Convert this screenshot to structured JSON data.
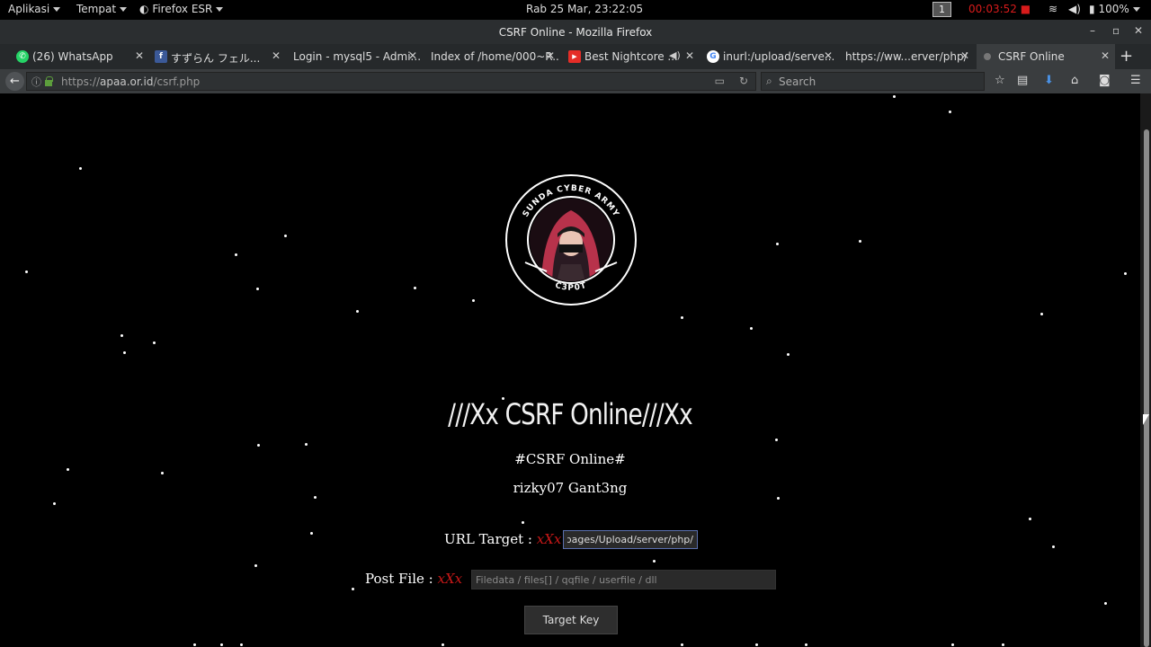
{
  "topbar": {
    "applications": "Aplikasi",
    "places": "Tempat",
    "app_name": "Firefox ESR",
    "clock": "Rab 25 Mar, 23:22:05",
    "workspace": "1",
    "recording_time": "00:03:52",
    "battery": "100%"
  },
  "window": {
    "title": "CSRF Online - Mozilla Firefox",
    "minimize": "–",
    "maximize": "▫",
    "close": "✕"
  },
  "tabs": [
    {
      "label": "(26) WhatsApp",
      "icon": "whatsapp-icon",
      "color": "#25d366"
    },
    {
      "label": "すずらん フェル...",
      "icon": "facebook-icon",
      "color": "#3b5998"
    },
    {
      "label": "Login - mysql5 - Admi...",
      "icon": "",
      "color": ""
    },
    {
      "label": "Index of /home/000~R...",
      "icon": "",
      "color": ""
    },
    {
      "label": "Best Nightcore ...",
      "icon": "youtube-icon",
      "color": "#e52d27"
    },
    {
      "label": "inurl:/upload/serve...",
      "icon": "google-icon",
      "color": "#ffffff"
    },
    {
      "label": "https://ww...erver/php/",
      "icon": "",
      "color": ""
    },
    {
      "label": "CSRF Online",
      "icon": "page-icon",
      "color": "#777777"
    }
  ],
  "nav": {
    "url_prefix": "https://",
    "url_host": "apaa.or.id",
    "url_path": "/csrf.php",
    "search_placeholder": "Search"
  },
  "page": {
    "logo_top_text": "SUNDA CYBER ARMY",
    "logo_bottom_text": "C3P0T",
    "heading": "∕∕∕Xx CSRF Online∕∕∕Xx",
    "subtitle": "#CSRF Online#",
    "authors": "rizky07 Gant3ng",
    "url_label": "URL Target : ",
    "url_marker": "xXx",
    "url_value": "/pages/Upload/server/php/",
    "post_label": "Post File : ",
    "post_marker": "xXx",
    "post_placeholder": "Filedata / files[] / qqfile / userfile / dll",
    "submit": "Target Key"
  },
  "colors": {
    "accent_red": "#c81818",
    "background": "#000000"
  }
}
